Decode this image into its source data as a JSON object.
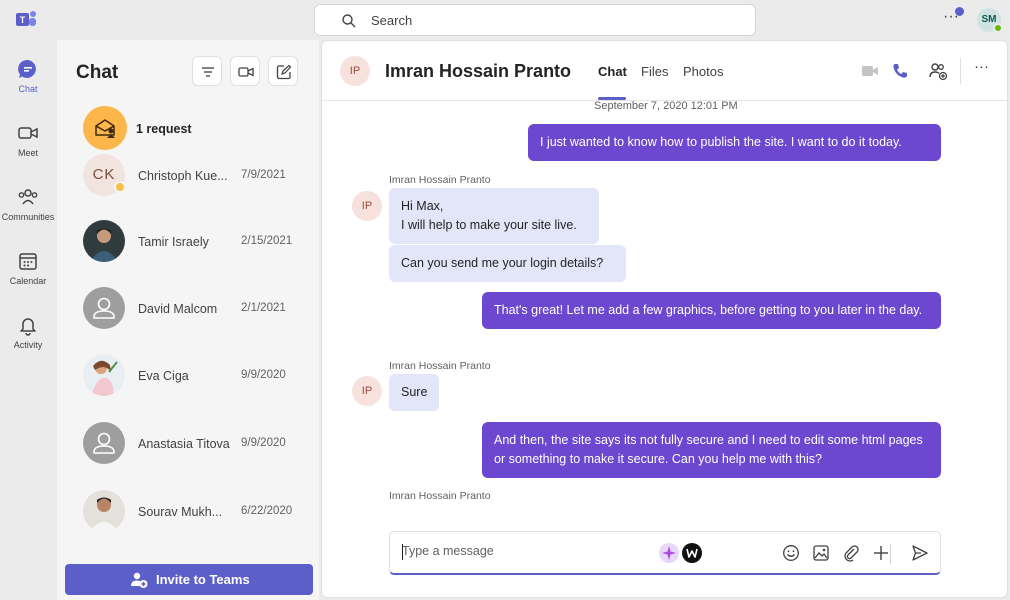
{
  "rail": {
    "items": [
      {
        "label": "Chat",
        "icon": "chat-icon"
      },
      {
        "label": "Meet",
        "icon": "video-icon"
      },
      {
        "label": "Communities",
        "icon": "communities-icon"
      },
      {
        "label": "Calendar",
        "icon": "calendar-icon"
      },
      {
        "label": "Activity",
        "icon": "bell-icon"
      }
    ]
  },
  "topbar": {
    "search_placeholder": "Search",
    "avatar_initials": "SM"
  },
  "chat_list": {
    "title": "Chat",
    "request_label": "1 request",
    "items": [
      {
        "name": "Christoph Kue...",
        "date": "7/9/2021",
        "initials": "CK"
      },
      {
        "name": "Tamir Israely",
        "date": "2/15/2021"
      },
      {
        "name": "David Malcom",
        "date": "2/1/2021"
      },
      {
        "name": "Eva Ciga",
        "date": "9/9/2020"
      },
      {
        "name": "Anastasia Titova",
        "date": "9/9/2020"
      },
      {
        "name": "Sourav Mukh...",
        "date": "6/22/2020"
      }
    ],
    "invite_label": "Invite to Teams"
  },
  "conversation": {
    "avatar_initials": "IP",
    "name": "Imran Hossain Pranto",
    "tabs": [
      "Chat",
      "Files",
      "Photos"
    ],
    "timestamp": "September 7, 2020 12:01 PM",
    "messages": {
      "m1": "I just wanted to know how to publish the site. I want to do it today.",
      "sender1": "Imran Hossain Pranto",
      "m2a": "Hi Max,",
      "m2b": "I will help to make your site live.",
      "m3": "Can you send me your login details?",
      "m4": "That's great! Let me add a few graphics, before getting to you later in the day.",
      "sender2": "Imran Hossain Pranto",
      "m5": "Sure",
      "m6": "And then, the site says its not fully secure and I need to edit some html pages or something to make it secure. Can you help me with this?",
      "sender3": "Imran Hossain Pranto"
    },
    "composer_placeholder": "Type a message"
  },
  "colors": {
    "accent": "#5b5fc7",
    "outgoing_bubble": "#6c47cf",
    "incoming_bubble": "#e3e5f8",
    "presence_available": "#6bb700"
  }
}
